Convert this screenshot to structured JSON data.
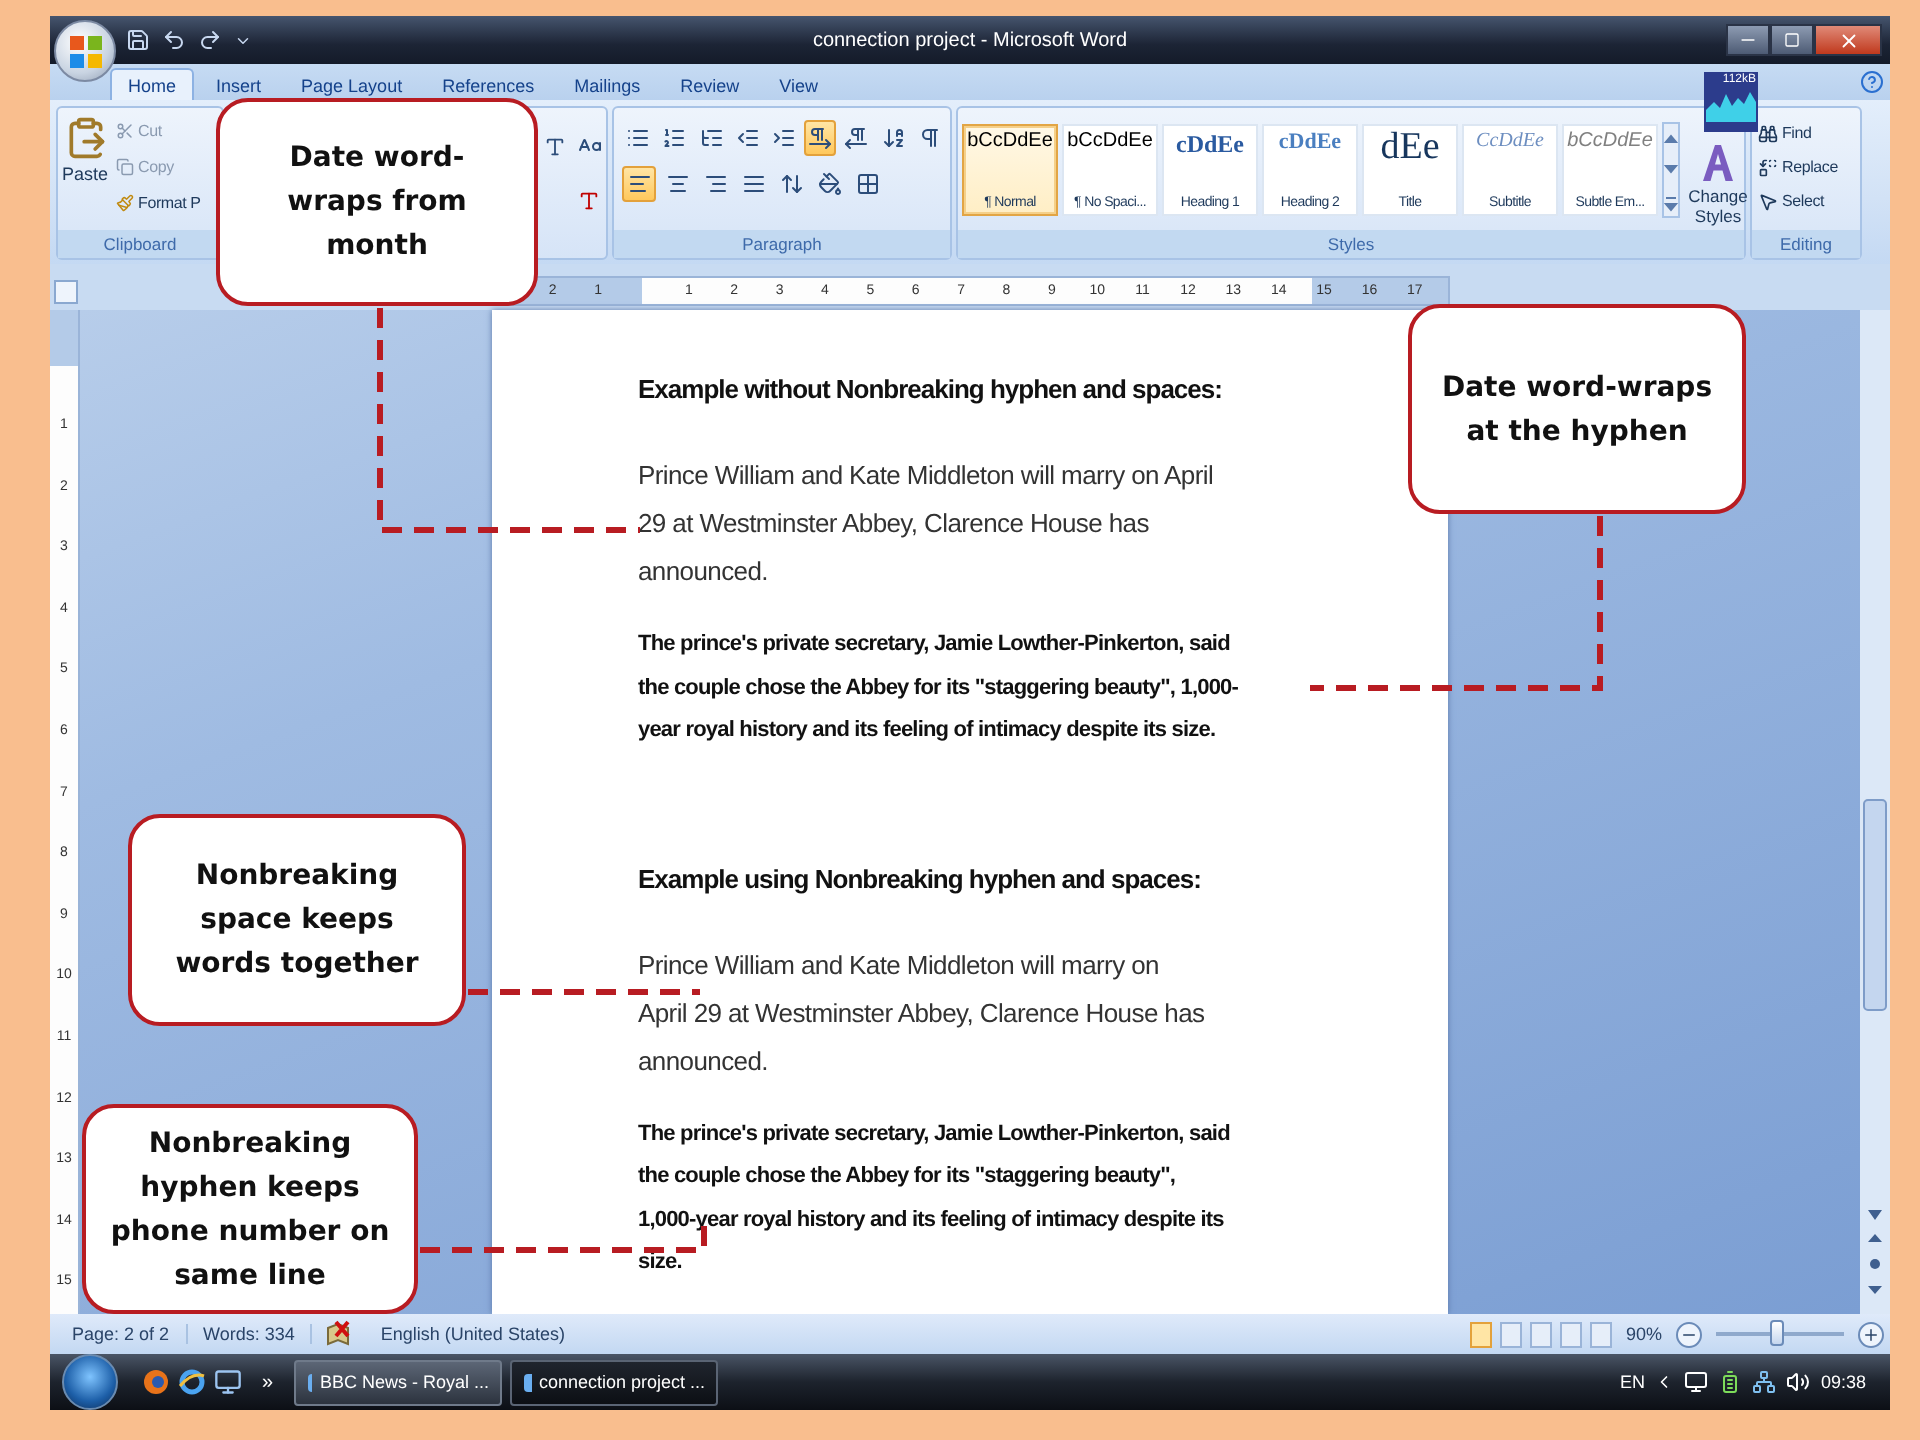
{
  "window": {
    "title": "connection project - Microsoft Word"
  },
  "ribbon_tabs": [
    {
      "label": "Home",
      "selected": true
    },
    {
      "label": "Insert",
      "selected": false
    },
    {
      "label": "Page Layout",
      "selected": false
    },
    {
      "label": "References",
      "selected": false
    },
    {
      "label": "Mailings",
      "selected": false
    },
    {
      "label": "Review",
      "selected": false
    },
    {
      "label": "View",
      "selected": false
    }
  ],
  "ribbon": {
    "clipboard": {
      "paste": "Paste",
      "cut": "Cut",
      "copy": "Copy",
      "format_painter": "Format P",
      "label": "Clipboard"
    },
    "paragraph": {
      "label": "Paragraph",
      "rows": [
        [
          {
            "kind": "bullets",
            "on": false
          },
          {
            "kind": "numbering",
            "on": false
          },
          {
            "kind": "multilevel",
            "on": false
          },
          {
            "kind": "outdent",
            "on": false
          },
          {
            "kind": "indent",
            "on": false
          },
          {
            "kind": "ltr",
            "on": true
          },
          {
            "kind": "rtl",
            "on": false
          },
          {
            "kind": "sort",
            "on": false
          },
          {
            "kind": "pilcrow",
            "on": false
          }
        ],
        [
          {
            "kind": "align-left",
            "on": true
          },
          {
            "kind": "align-center",
            "on": false
          },
          {
            "kind": "align-right",
            "on": false
          },
          {
            "kind": "justify",
            "on": false
          },
          {
            "kind": "line-spacing",
            "on": false
          },
          {
            "kind": "shading",
            "on": false
          },
          {
            "kind": "borders",
            "on": false
          }
        ]
      ]
    },
    "styles": {
      "label": "Styles",
      "items": [
        {
          "kind": "normal",
          "sample": "bCcDdEe",
          "name": "¶ Normal",
          "selected": true
        },
        {
          "kind": "normal",
          "sample": "bCcDdEe",
          "name": "¶ No Spaci...",
          "selected": false
        },
        {
          "kind": "heading1",
          "sample": "cDdEe",
          "name": "Heading 1",
          "selected": false
        },
        {
          "kind": "heading2",
          "sample": "cDdEe",
          "name": "Heading 2",
          "selected": false
        },
        {
          "kind": "title",
          "sample": "dEe",
          "name": "Title",
          "selected": false
        },
        {
          "kind": "subtitle",
          "sample": "CcDdEe",
          "name": "Subtitle",
          "selected": false
        },
        {
          "kind": "emphasis",
          "sample": "bCcDdEe",
          "name": "Subtle Em...",
          "selected": false
        }
      ]
    },
    "change_styles": "Change Styles",
    "editing": {
      "find": "Find",
      "replace": "Replace",
      "select": "Select",
      "label": "Editing"
    },
    "network_meter": "112kB"
  },
  "ruler": {
    "horizontal": [
      "2",
      "1",
      "1",
      "2",
      "3",
      "4",
      "5",
      "6",
      "7",
      "8",
      "9",
      "10",
      "11",
      "12",
      "13",
      "14",
      "15",
      "16",
      "17"
    ],
    "vertical": [
      "1",
      "2",
      "3",
      "4",
      "5",
      "6",
      "7",
      "8",
      "9",
      "10",
      "11",
      "12",
      "13",
      "14",
      "15"
    ]
  },
  "document": {
    "sections": [
      {
        "heading": "Example without Nonbreaking hyphen and spaces:",
        "paragraphs": [
          {
            "kind": "regular",
            "lines": [
              "Prince William and Kate Middleton will marry on April",
              "29 at Westminster Abbey, Clarence House has",
              "announced."
            ]
          },
          {
            "kind": "bold",
            "lines": [
              "The prince's private secretary, Jamie Lowther-Pinkerton, said",
              "the couple chose the Abbey for its \"staggering beauty\", 1,000-",
              "year royal history and its feeling of intimacy despite its size."
            ]
          }
        ]
      },
      {
        "heading": "Example using Nonbreaking hyphen and spaces:",
        "paragraphs": [
          {
            "kind": "regular",
            "lines": [
              "Prince William and Kate Middleton will marry on",
              "April 29 at Westminster Abbey, Clarence House has",
              "announced."
            ]
          },
          {
            "kind": "bold",
            "lines": [
              "The prince's private secretary, Jamie Lowther-Pinkerton, said",
              "the couple chose the Abbey for its \"staggering beauty\",",
              "1,000-year royal history and its feeling of intimacy despite its",
              "size."
            ]
          }
        ]
      }
    ]
  },
  "callouts": [
    {
      "text": "Date word-wraps from month"
    },
    {
      "text": "Date word-wraps at the hyphen"
    },
    {
      "text": "Nonbreaking space keeps words together"
    },
    {
      "text": "Nonbreaking hyphen keeps phone number on same line"
    }
  ],
  "status_bar": {
    "page": "Page: 2 of 2",
    "words": "Words: 334",
    "language": "English (United States)",
    "zoom": "90%",
    "zoom_slider": {
      "level": 0.47
    }
  },
  "taskbar": {
    "overflow": "»",
    "buttons": [
      {
        "label": "BBC News - Royal ...",
        "selected": false
      },
      {
        "label": "connection project ...",
        "selected": true
      }
    ],
    "language": "EN",
    "time": "09:38"
  }
}
